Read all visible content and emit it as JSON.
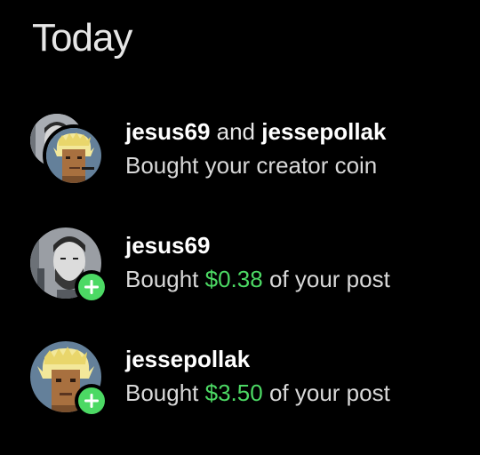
{
  "section": {
    "title": "Today"
  },
  "theme": {
    "accent": "#4cd964",
    "background": "#000000",
    "text": "#ffffff"
  },
  "notifications": [
    {
      "avatar_icons": [
        "photo-avatar",
        "pixel-punk-avatar"
      ],
      "user_a": "jesus69",
      "conjunction": "and",
      "user_b": "jessepollak",
      "action": "Bought your creator coin"
    },
    {
      "avatar_icon": "photo-avatar",
      "badge_icon": "plus-icon",
      "user": "jesus69",
      "action_prefix": "Bought",
      "amount": "$0.38",
      "action_suffix": "of your post"
    },
    {
      "avatar_icon": "pixel-punk-avatar",
      "badge_icon": "plus-icon",
      "user": "jessepollak",
      "action_prefix": "Bought",
      "amount": "$3.50",
      "action_suffix": "of your post"
    }
  ]
}
